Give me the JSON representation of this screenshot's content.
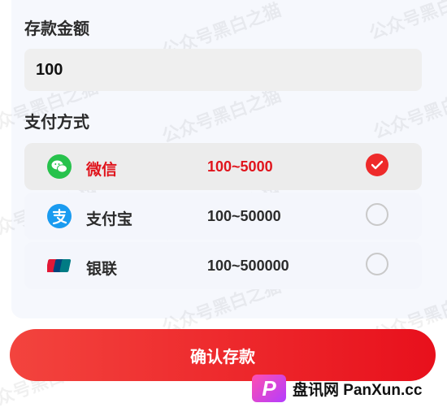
{
  "deposit": {
    "amount_label": "存款金额",
    "amount_value": "100",
    "method_label": "支付方式"
  },
  "methods": [
    {
      "name": "微信",
      "range": "100~5000",
      "icon": "wechat-icon",
      "selected": true
    },
    {
      "name": "支付宝",
      "range": "100~50000",
      "icon": "alipay-icon",
      "selected": false
    },
    {
      "name": "银联",
      "range": "100~500000",
      "icon": "unionpay-icon",
      "selected": false
    }
  ],
  "confirm_label": "确认存款",
  "watermark_text": "公众号黑白之猫",
  "brand": {
    "logo_letter": "P",
    "text": "盘讯网 PanXun.cc"
  },
  "colors": {
    "accent": "#e0141c",
    "button_gradient": [
      "#f3443e",
      "#e8101c"
    ]
  }
}
